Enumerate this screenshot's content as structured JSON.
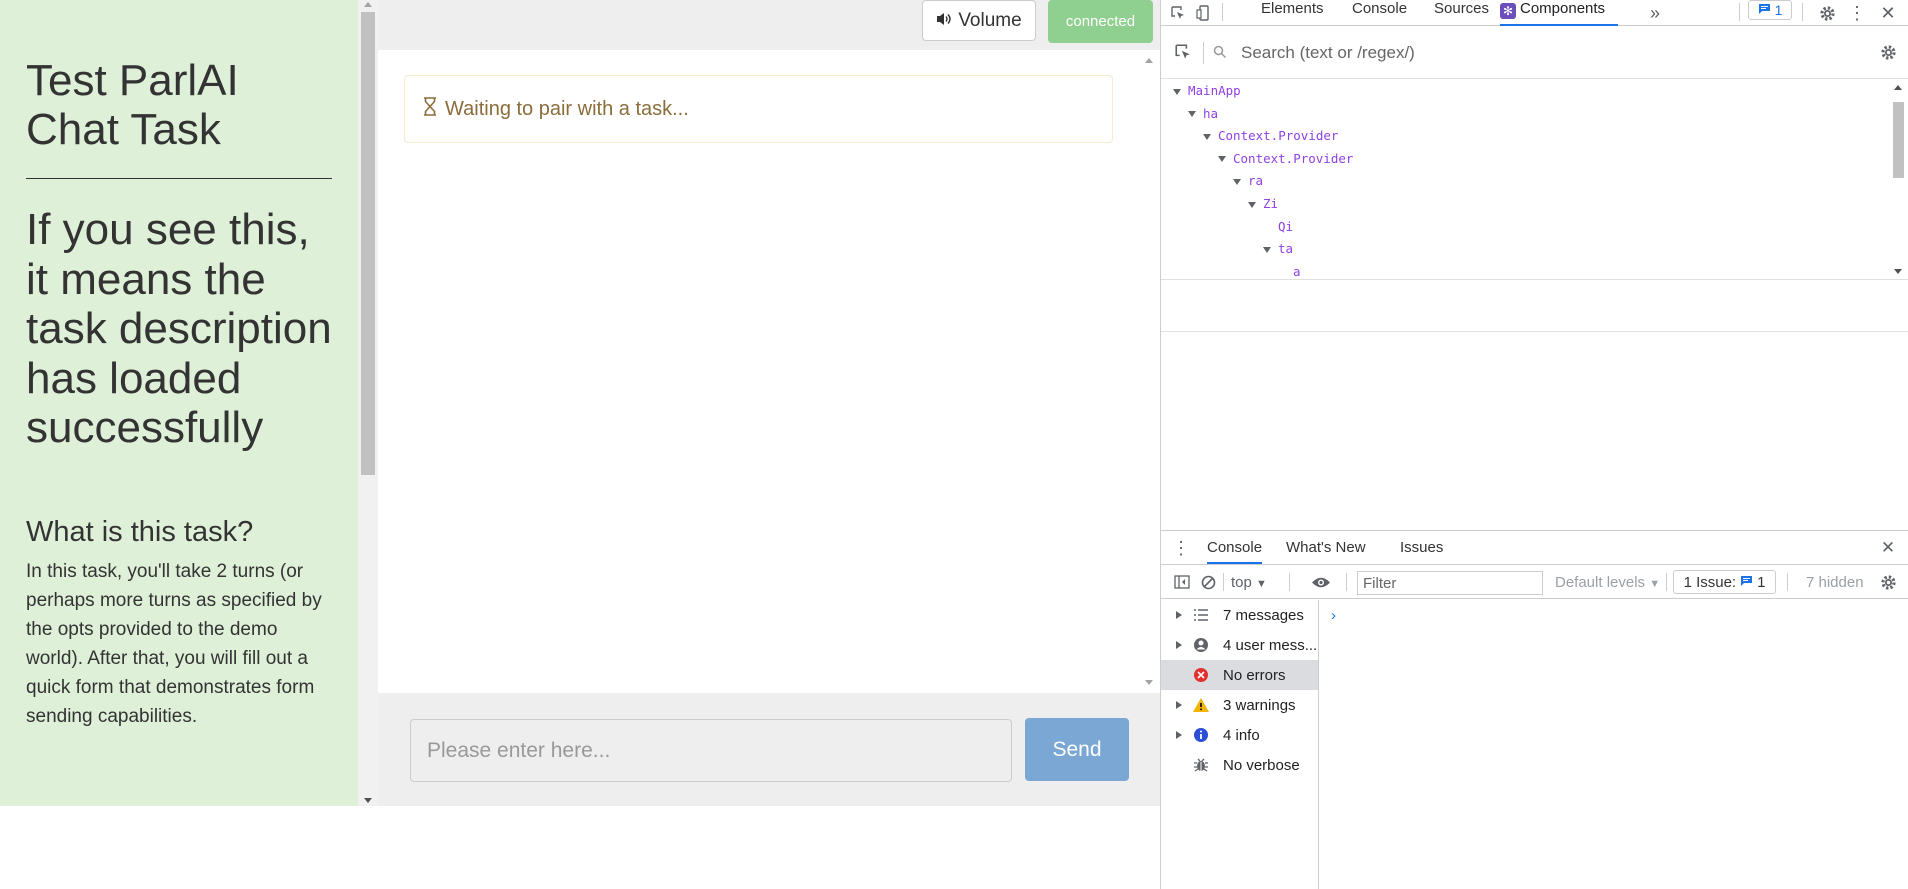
{
  "task": {
    "title": "Test ParlAI Chat Task",
    "description": "If you see this, it means the task description has loaded successfully",
    "section_heading": "What is this task?",
    "section_body": "In this task, you'll take 2 turns (or perhaps more turns as specified by the opts provided to the demo world). After that, you will fill out a quick form that demonstrates form sending capabilities."
  },
  "chat": {
    "volume_label": "Volume",
    "status_badge": "connected",
    "waiting_message": "Waiting to pair with a task...",
    "input_placeholder": "Please enter here...",
    "send_label": "Send"
  },
  "devtools": {
    "tabs": [
      "Elements",
      "Console",
      "Sources",
      "Components"
    ],
    "active_tab": "Components",
    "issues_count": "1",
    "search_placeholder": "Search (text or /regex/)",
    "tree": [
      {
        "label": "MainApp",
        "expanded": true
      },
      {
        "label": "ha",
        "expanded": true
      },
      {
        "label": "Context.Provider",
        "expanded": true
      },
      {
        "label": "Context.Provider",
        "expanded": true
      },
      {
        "label": "ra",
        "expanded": true
      },
      {
        "label": "Zi",
        "expanded": true
      },
      {
        "label": "Qi",
        "expanded": false
      },
      {
        "label": "ta",
        "expanded": true
      },
      {
        "label": "a",
        "expanded": false
      }
    ],
    "drawer": {
      "tabs": [
        "Console",
        "What's New",
        "Issues"
      ],
      "active_tab": "Console",
      "context": "top",
      "filter_placeholder": "Filter",
      "levels_label": "Default levels",
      "issue_chip_label": "1 Issue:",
      "issue_chip_count": "1",
      "hidden_label": "7 hidden",
      "sidebar": [
        {
          "label": "7 messages",
          "icon": "list-icon",
          "expandable": true
        },
        {
          "label": "4 user mess...",
          "icon": "user-icon",
          "expandable": true
        },
        {
          "label": "No errors",
          "icon": "error-icon",
          "expandable": false
        },
        {
          "label": "3 warnings",
          "icon": "warning-icon",
          "expandable": true
        },
        {
          "label": "4 info",
          "icon": "info-icon",
          "expandable": true
        },
        {
          "label": "No verbose",
          "icon": "bug-icon",
          "expandable": false
        }
      ],
      "prompt": "›"
    }
  },
  "colors": {
    "task_pane_bg": "#dff0d8",
    "connected_green": "#8fcf8f",
    "send_blue": "#7aa7d3",
    "warning_text": "#8a6d3b",
    "accent_blue": "#1a73e8",
    "component_purple": "#8f41e4"
  }
}
